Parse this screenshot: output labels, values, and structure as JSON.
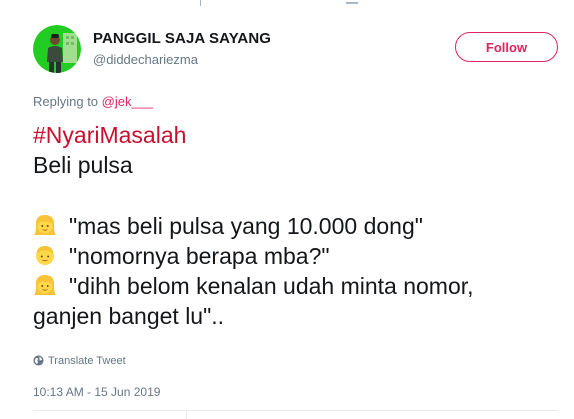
{
  "author": {
    "display_name": "PANGGIL SAJA SAYANG",
    "handle": "@diddechariezma",
    "follow_label": "Follow"
  },
  "reply": {
    "prefix": "Replying to ",
    "mention": "@jek___"
  },
  "tweet": {
    "hashtag": "#NyariMasalah",
    "line1": "Beli pulsa",
    "line2": "\"mas beli pulsa yang 10.000 dong\"",
    "line3": "\"nomornya berapa mba?\"",
    "line4": "\"dihh belom kenalan udah minta nomor,",
    "line5": "ganjen banget lu\".."
  },
  "translate_label": "Translate Tweet",
  "timestamp": "10:13 AM - 15 Jun 2019",
  "colors": {
    "accent": "#e0245e",
    "hashtag": "#c8102e",
    "muted": "#657786",
    "text": "#14171a",
    "avatar_bg": "#22cc22"
  },
  "icons": {
    "avatar": "user-avatar",
    "woman_emoji": "woman-face-icon",
    "man_emoji": "man-face-icon",
    "translate": "globe-icon"
  }
}
